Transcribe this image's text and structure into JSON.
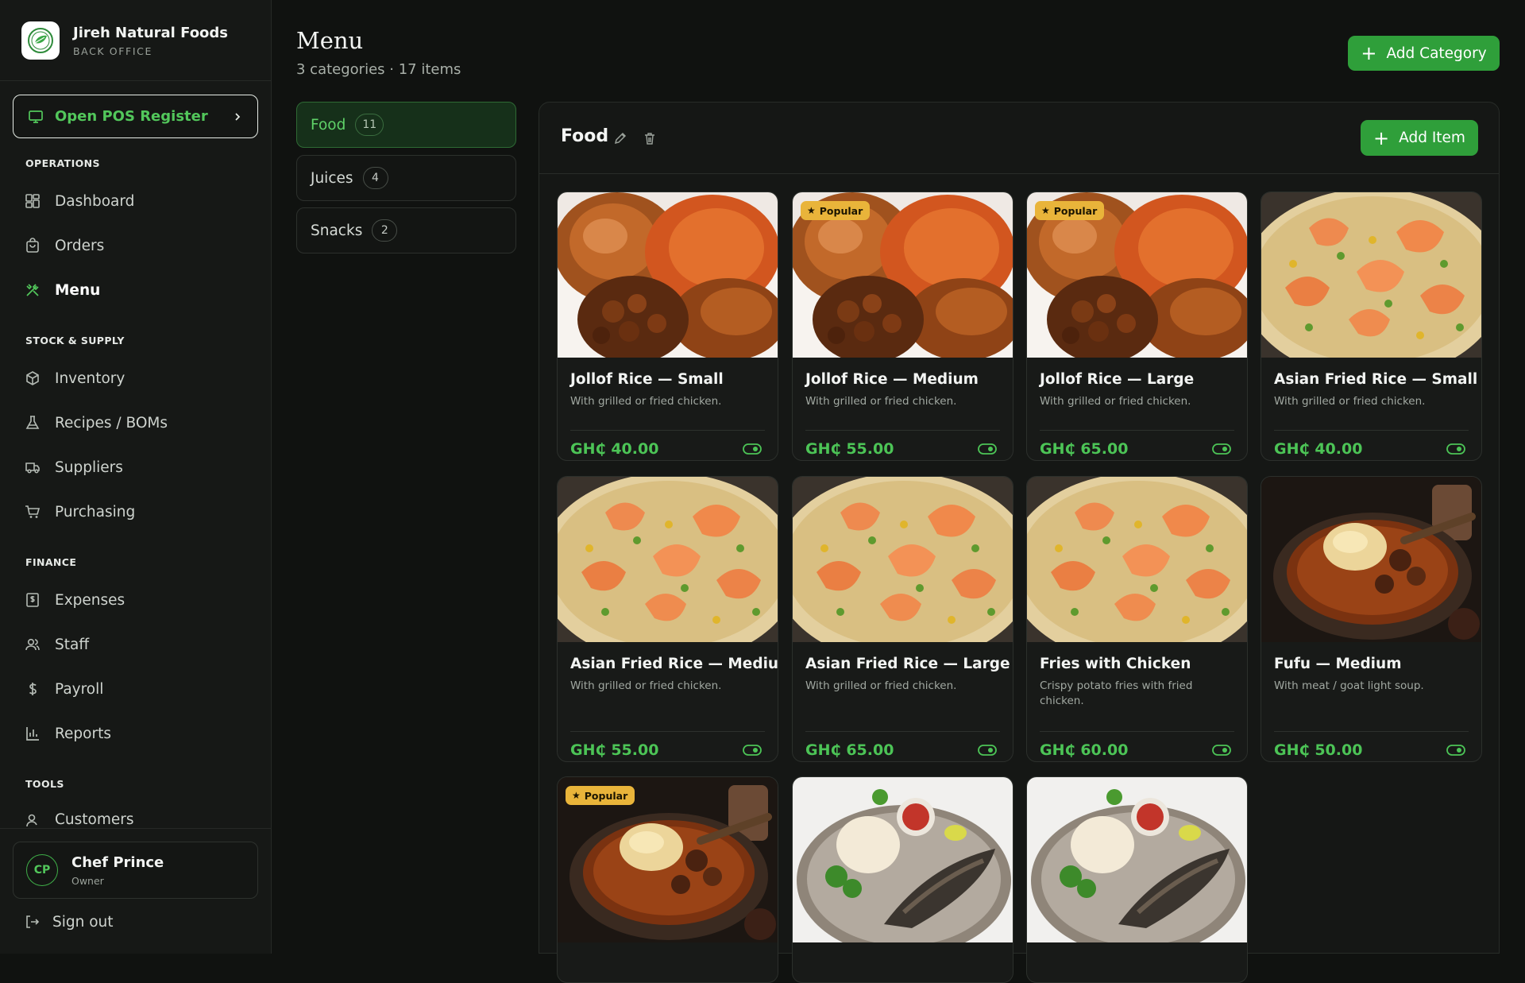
{
  "brand": {
    "name": "Jireh Natural Foods",
    "subtitle": "BACK OFFICE"
  },
  "pos_button": {
    "label": "Open POS Register"
  },
  "nav": {
    "operations": {
      "title": "OPERATIONS",
      "items": [
        {
          "label": "Dashboard",
          "icon": "grid-icon"
        },
        {
          "label": "Orders",
          "icon": "bag-icon"
        },
        {
          "label": "Menu",
          "icon": "utensils-icon",
          "active": true
        }
      ]
    },
    "stock": {
      "title": "STOCK & SUPPLY",
      "items": [
        {
          "label": "Inventory",
          "icon": "box-icon"
        },
        {
          "label": "Recipes / BOMs",
          "icon": "flask-icon"
        },
        {
          "label": "Suppliers",
          "icon": "truck-icon"
        },
        {
          "label": "Purchasing",
          "icon": "cart-icon"
        }
      ]
    },
    "finance": {
      "title": "FINANCE",
      "items": [
        {
          "label": "Expenses",
          "icon": "receipt-icon"
        },
        {
          "label": "Staff",
          "icon": "users-icon"
        },
        {
          "label": "Payroll",
          "icon": "dollar-icon"
        },
        {
          "label": "Reports",
          "icon": "bar-chart-icon"
        }
      ]
    },
    "tools": {
      "title": "TOOLS",
      "items": [
        {
          "label": "Customers",
          "icon": "user-icon"
        }
      ]
    }
  },
  "user": {
    "initials": "CP",
    "name": "Chef Prince",
    "role": "Owner"
  },
  "signout": {
    "label": "Sign out"
  },
  "page": {
    "title": "Menu",
    "subtitle": "3 categories · 17 items",
    "add_category_label": "Add Category"
  },
  "categories": [
    {
      "name": "Food",
      "count": "11",
      "active": true
    },
    {
      "name": "Juices",
      "count": "4"
    },
    {
      "name": "Snacks",
      "count": "2"
    }
  ],
  "panel": {
    "title": "Food",
    "add_item_label": "Add Item"
  },
  "popular_label": "Popular",
  "items": [
    {
      "name": "Jollof Rice — Small",
      "desc": "With grilled or fried chicken.",
      "price": "GH₵ 40.00",
      "popular": false,
      "image": "jollof"
    },
    {
      "name": "Jollof Rice — Medium",
      "desc": "With grilled or fried chicken.",
      "price": "GH₵ 55.00",
      "popular": true,
      "image": "jollof"
    },
    {
      "name": "Jollof Rice — Large",
      "desc": "With grilled or fried chicken.",
      "price": "GH₵ 65.00",
      "popular": true,
      "image": "jollof"
    },
    {
      "name": "Asian Fried Rice — Small",
      "desc": "With grilled or fried chicken.",
      "price": "GH₵ 40.00",
      "popular": false,
      "image": "fried-rice"
    },
    {
      "name": "Asian Fried Rice — Medium",
      "desc": "With grilled or fried chicken.",
      "price": "GH₵ 55.00",
      "popular": false,
      "image": "fried-rice"
    },
    {
      "name": "Asian Fried Rice — Large",
      "desc": "With grilled or fried chicken.",
      "price": "GH₵ 65.00",
      "popular": false,
      "image": "fried-rice"
    },
    {
      "name": "Fries with Chicken",
      "desc": "Crispy potato fries with fried chicken.",
      "price": "GH₵ 60.00",
      "popular": false,
      "image": "fried-rice"
    },
    {
      "name": "Fufu — Medium",
      "desc": "With meat / goat light soup.",
      "price": "GH₵ 50.00",
      "popular": false,
      "image": "fufu"
    },
    {
      "name": "",
      "desc": "",
      "price": "",
      "popular": true,
      "image": "fufu"
    },
    {
      "name": "",
      "desc": "",
      "price": "",
      "popular": false,
      "image": "banku-fish"
    },
    {
      "name": "",
      "desc": "",
      "price": "",
      "popular": false,
      "image": "banku-fish"
    }
  ],
  "colors": {
    "accent": "#2f9f3a",
    "accent_text": "#52c75b",
    "popular_badge": "#e9b43a",
    "background": "#101210"
  }
}
